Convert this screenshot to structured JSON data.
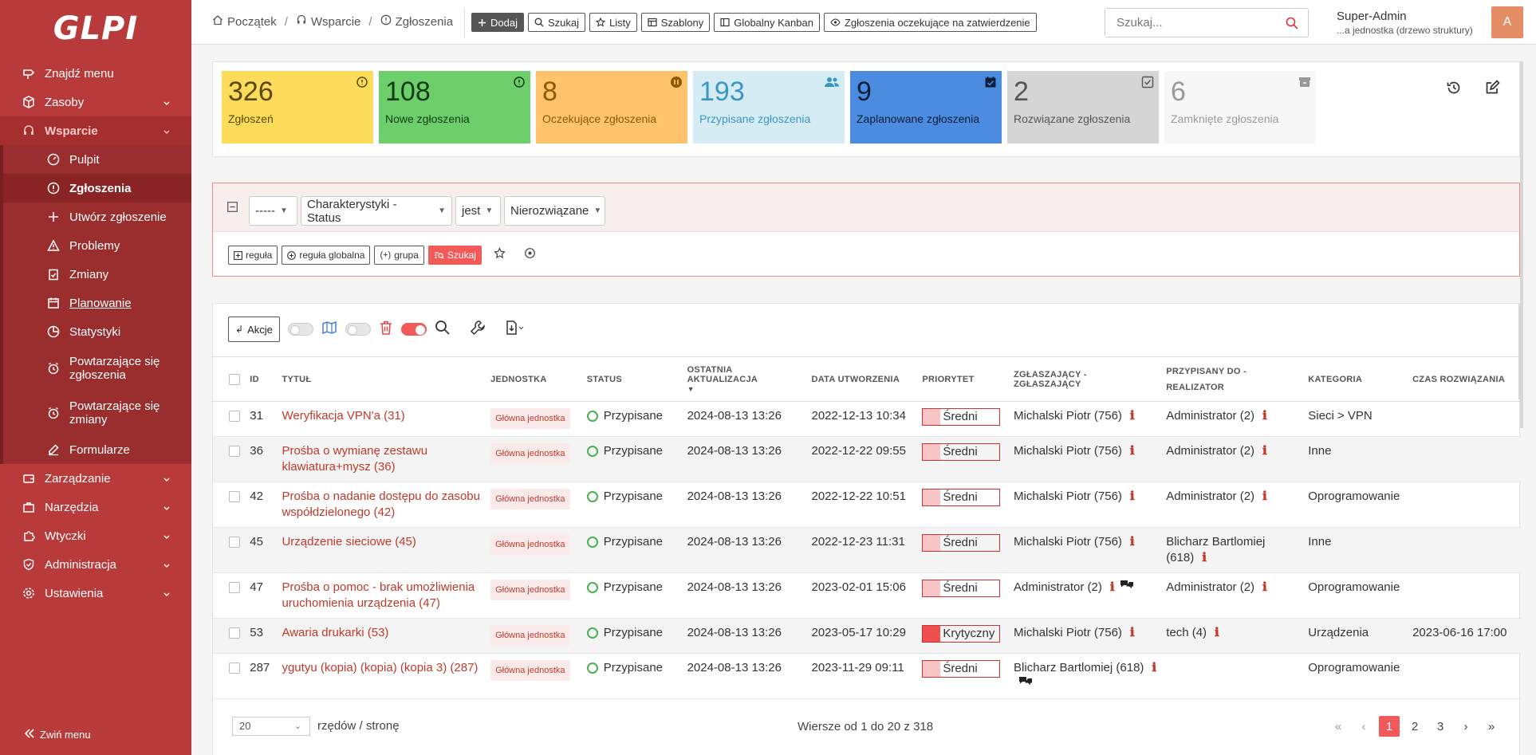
{
  "app": {
    "logo": "GLPI"
  },
  "sidebar": {
    "items": [
      {
        "label": "Znajdź menu"
      },
      {
        "label": "Zasoby"
      },
      {
        "label": "Wsparcie"
      },
      {
        "label": "Zarządzanie"
      },
      {
        "label": "Narzędzia"
      },
      {
        "label": "Wtyczki"
      },
      {
        "label": "Administracja"
      },
      {
        "label": "Ustawienia"
      }
    ],
    "sub": [
      {
        "label": "Pulpit"
      },
      {
        "label": "Zgłoszenia"
      },
      {
        "label": "Utwórz zgłoszenie"
      },
      {
        "label": "Problemy"
      },
      {
        "label": "Zmiany"
      },
      {
        "label": "Planowanie"
      },
      {
        "label": "Statystyki"
      },
      {
        "label": "Powtarzające się zgłoszenia"
      },
      {
        "label": "Powtarzające się zmiany"
      },
      {
        "label": "Formularze"
      }
    ],
    "collapse": "Zwiń menu"
  },
  "header": {
    "breadcrumb": [
      "Początek",
      "Wsparcie",
      "Zgłoszenia"
    ],
    "buttons": [
      "Dodaj",
      "Szukaj",
      "Listy",
      "Szablony",
      "Globalny Kanban",
      "Zgłoszenia oczekujące na zatwierdzenie"
    ],
    "search_placeholder": "Szukaj...",
    "user_name": "Super-Admin",
    "user_entity": "...a jednostka (drzewo struktury)",
    "avatar": "A"
  },
  "stats": [
    {
      "value": "326",
      "label": "Zgłoszeń",
      "bg": "#fddc5c",
      "fg": "#5a4700"
    },
    {
      "value": "108",
      "label": "Nowe zgłoszenia",
      "bg": "#6ccf6c",
      "fg": "#133b13"
    },
    {
      "value": "8",
      "label": "Oczekujące zgłoszenia",
      "bg": "#ffc36b",
      "fg": "#8a5a00"
    },
    {
      "value": "193",
      "label": "Przypisane zgłoszenia",
      "bg": "#d6ecf5",
      "fg": "#3a97c2"
    },
    {
      "value": "9",
      "label": "Zaplanowane zgłoszenia",
      "bg": "#4c8ce0",
      "fg": "#0d1f3a"
    },
    {
      "value": "2",
      "label": "Rozwiązane zgłoszenia",
      "bg": "#d5d5d5",
      "fg": "#555555"
    },
    {
      "value": "6",
      "label": "Zamknięte zgłoszenia",
      "bg": "#f7f7f7",
      "fg": "#999999"
    }
  ],
  "filter": {
    "field1": "-----",
    "field2": "Charakterystyki - Status",
    "operator": "jest",
    "value": "Nierozwiązane",
    "buttons": [
      "reguła",
      "reguła globalna",
      "grupa",
      "Szukaj"
    ]
  },
  "list": {
    "actions_label": "Akcje",
    "columns": [
      "ID",
      "TYTUŁ",
      "JEDNOSTKA",
      "STATUS",
      "OSTATNIA AKTUALIZACJA",
      "DATA UTWORZENIA",
      "PRIORYTET",
      "ZGŁASZAJĄCY - ZGŁASZAJĄCY",
      "PRZYPISANY DO - REALIZATOR",
      "KATEGORIA",
      "CZAS ROZWIĄZANIA"
    ],
    "rows": [
      {
        "id": "31",
        "title": "Weryfikacja VPN'a (31)",
        "entity": "Główna jednostka",
        "status": "Przypisane",
        "updated": "2024-08-13 13:26",
        "created": "2022-12-13 10:34",
        "priority": "Średni",
        "priority_color": "#f7c5c5",
        "requester": "Michalski Piotr (756)",
        "assigned": "Administrator (2)",
        "category": "Sieci > VPN",
        "due": ""
      },
      {
        "id": "36",
        "title": "Prośba o wymianę zestawu klawiatura+mysz (36)",
        "entity": "Główna jednostka",
        "status": "Przypisane",
        "updated": "2024-08-13 13:26",
        "created": "2022-12-22 09:55",
        "priority": "Średni",
        "priority_color": "#f7c5c5",
        "requester": "Michalski Piotr (756)",
        "assigned": "Administrator (2)",
        "category": "Inne",
        "due": ""
      },
      {
        "id": "42",
        "title": "Prośba o nadanie dostępu do zasobu współdzielonego (42)",
        "entity": "Główna jednostka",
        "status": "Przypisane",
        "updated": "2024-08-13 13:26",
        "created": "2022-12-22 10:51",
        "priority": "Średni",
        "priority_color": "#f7c5c5",
        "requester": "Michalski Piotr (756)",
        "assigned": "Administrator (2)",
        "category": "Oprogramowanie",
        "due": ""
      },
      {
        "id": "45",
        "title": "Urządzenie sieciowe (45)",
        "entity": "Główna jednostka",
        "status": "Przypisane",
        "updated": "2024-08-13 13:26",
        "created": "2022-12-23 11:31",
        "priority": "Średni",
        "priority_color": "#f7c5c5",
        "requester": "Michalski Piotr (756)",
        "assigned": "Blicharz Bartlomiej (618)",
        "category": "Inne",
        "due": ""
      },
      {
        "id": "47",
        "title": "Prośba o pomoc - brak umożliwienia uruchomienia urządzenia (47)",
        "entity": "Główna jednostka",
        "status": "Przypisane",
        "updated": "2024-08-13 13:26",
        "created": "2023-02-01 15:06",
        "priority": "Średni",
        "priority_color": "#f7c5c5",
        "requester": "Administrator (2)",
        "assigned": "Administrator (2)",
        "category": "Oprogramowanie",
        "due": ""
      },
      {
        "id": "53",
        "title": "Awaria drukarki (53)",
        "entity": "Główna jednostka",
        "status": "Przypisane",
        "updated": "2024-08-13 13:26",
        "created": "2023-05-17 10:29",
        "priority": "Krytyczny",
        "priority_color": "#ee5050",
        "requester": "Michalski Piotr (756)",
        "assigned": "tech (4)",
        "category": "Urządzenia",
        "due": "2023-06-16 17:00"
      },
      {
        "id": "287",
        "title": "ygutyu (kopia) (kopia) (kopia 3) (287)",
        "entity": "Główna jednostka",
        "status": "Przypisane",
        "updated": "2024-08-13 13:26",
        "created": "2023-11-29 09:11",
        "priority": "Średni",
        "priority_color": "#f7c5c5",
        "requester": "Blicharz Bartlomiej (618)",
        "assigned": "",
        "category": "Oprogramowanie",
        "due": ""
      }
    ]
  },
  "pager": {
    "per_page": "20",
    "per_page_label": "rzędów / stronę",
    "info": "Wiersze od 1 do 20 z 318",
    "pages": [
      "1",
      "2",
      "3"
    ]
  }
}
